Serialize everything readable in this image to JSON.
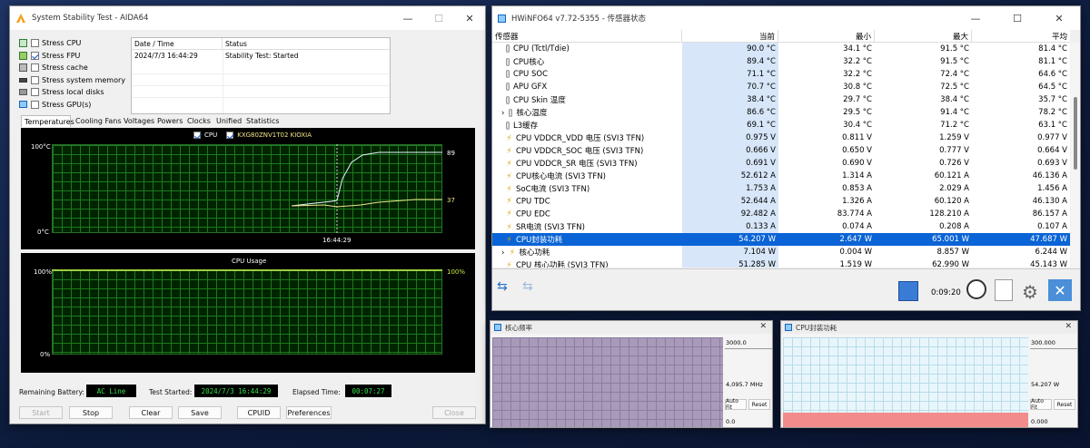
{
  "aida": {
    "title": "System Stability Test - AIDA64",
    "stress": [
      {
        "label": "Stress CPU",
        "checked": false
      },
      {
        "label": "Stress FPU",
        "checked": true
      },
      {
        "label": "Stress cache",
        "checked": false
      },
      {
        "label": "Stress system memory",
        "checked": false
      },
      {
        "label": "Stress local disks",
        "checked": false
      },
      {
        "label": "Stress GPU(s)",
        "checked": false
      }
    ],
    "log": {
      "col_date": "Date / Time",
      "col_status": "Status",
      "row_date": "2024/7/3 16:44:29",
      "row_status": "Stability Test: Started"
    },
    "tabs": [
      "Temperatures",
      "Cooling Fans",
      "Voltages",
      "Powers",
      "Clocks",
      "Unified",
      "Statistics"
    ],
    "temp_graph": {
      "legend_cpu": "CPU",
      "legend_disk": "KXG80ZNV1T02 KIOXIA",
      "y_top": "100°C",
      "y_bottom": "0°C",
      "x_time": "16:44:29",
      "val_cpu": "89",
      "val_disk": "37"
    },
    "usage_graph": {
      "title": "CPU Usage",
      "y_top": "100%",
      "y_bottom": "0%",
      "val": "100%"
    },
    "status": {
      "battery_label": "Remaining Battery:",
      "battery": "AC Line",
      "started_label": "Test Started:",
      "started": "2024/7/3 16:44:29",
      "elapsed_label": "Elapsed Time:",
      "elapsed": "00:07:27"
    },
    "buttons": {
      "start": "Start",
      "stop": "Stop",
      "clear": "Clear",
      "save": "Save",
      "cpuid": "CPUID",
      "prefs": "Preferences",
      "close": "Close"
    },
    "colors": {
      "cpu_line": "#e8f4ff",
      "disk_line": "#f0e68c",
      "usage_line": "#c6e84a"
    }
  },
  "hwinfo": {
    "title": "HWiNFO64 v7.72-5355 - 传感器状态",
    "headers": {
      "sensor": "传感器",
      "current": "当前",
      "min": "最小",
      "max": "最大",
      "avg": "平均"
    },
    "rows": [
      {
        "icon": "thermometer-icon",
        "name": "CPU (Tctl/Tdie)",
        "cur": "90.0 °C",
        "min": "34.1 °C",
        "max": "91.5 °C",
        "avg": "81.4 °C"
      },
      {
        "icon": "thermometer-icon",
        "name": "CPU核心",
        "cur": "89.4 °C",
        "min": "32.2 °C",
        "max": "91.5 °C",
        "avg": "81.1 °C"
      },
      {
        "icon": "thermometer-icon",
        "name": "CPU SOC",
        "cur": "71.1 °C",
        "min": "32.2 °C",
        "max": "72.4 °C",
        "avg": "64.6 °C"
      },
      {
        "icon": "thermometer-icon",
        "name": "APU GFX",
        "cur": "70.7 °C",
        "min": "30.8 °C",
        "max": "72.5 °C",
        "avg": "64.5 °C"
      },
      {
        "icon": "thermometer-icon",
        "name": "CPU Skin 温度",
        "cur": "38.4 °C",
        "min": "29.7 °C",
        "max": "38.4 °C",
        "avg": "35.7 °C"
      },
      {
        "icon": "thermometer-icon",
        "name": "核心温度",
        "expand": true,
        "cur": "86.6 °C",
        "min": "29.5 °C",
        "max": "91.4 °C",
        "avg": "78.2 °C"
      },
      {
        "icon": "thermometer-icon",
        "name": "L3缓存",
        "cur": "69.1 °C",
        "min": "30.4 °C",
        "max": "71.2 °C",
        "avg": "63.1 °C"
      },
      {
        "icon": "bolt-icon",
        "name": "CPU VDDCR_VDD 电压 (SVI3 TFN)",
        "cur": "0.975 V",
        "min": "0.811 V",
        "max": "1.259 V",
        "avg": "0.977 V"
      },
      {
        "icon": "bolt-icon",
        "name": "CPU VDDCR_SOC 电压 (SVI3 TFN)",
        "cur": "0.666 V",
        "min": "0.650 V",
        "max": "0.777 V",
        "avg": "0.664 V"
      },
      {
        "icon": "bolt-icon",
        "name": "CPU VDDCR_SR 电压 (SVI3 TFN)",
        "cur": "0.691 V",
        "min": "0.690 V",
        "max": "0.726 V",
        "avg": "0.693 V"
      },
      {
        "icon": "bolt-icon",
        "name": "CPU核心电流 (SVI3 TFN)",
        "cur": "52.612 A",
        "min": "1.314 A",
        "max": "60.121 A",
        "avg": "46.136 A"
      },
      {
        "icon": "bolt-icon",
        "name": "SoC电流 (SVI3 TFN)",
        "cur": "1.753 A",
        "min": "0.853 A",
        "max": "2.029 A",
        "avg": "1.456 A"
      },
      {
        "icon": "bolt-icon",
        "name": "CPU TDC",
        "cur": "52.644 A",
        "min": "1.326 A",
        "max": "60.120 A",
        "avg": "46.130 A"
      },
      {
        "icon": "bolt-icon",
        "name": "CPU EDC",
        "cur": "92.482 A",
        "min": "83.774 A",
        "max": "128.210 A",
        "avg": "86.157 A"
      },
      {
        "icon": "bolt-icon",
        "name": "SR电流 (SVI3 TFN)",
        "cur": "0.133 A",
        "min": "0.074 A",
        "max": "0.208 A",
        "avg": "0.107 A"
      },
      {
        "icon": "bolt-icon",
        "name": "CPU封装功耗",
        "selected": true,
        "cur": "54.207 W",
        "min": "2.647 W",
        "max": "65.001 W",
        "avg": "47.687 W"
      },
      {
        "icon": "bolt-icon",
        "name": "核心功耗",
        "expand": true,
        "cur": "7.104 W",
        "min": "0.004 W",
        "max": "8.857 W",
        "avg": "6.244 W"
      },
      {
        "icon": "bolt-icon",
        "name": "CPU 核心功耗 (SVI3 TFN)",
        "cur": "51.285 W",
        "min": "1.519 W",
        "max": "62.990 W",
        "avg": "45.143 W"
      }
    ],
    "timer": "0:09:20"
  },
  "graph1": {
    "title": "核心频率",
    "max": "3000.0",
    "cur": "4,095.7 MHz",
    "min": "0.0",
    "auto": "Auto Fit",
    "reset": "Reset",
    "color": "#a89ab8"
  },
  "graph2": {
    "title": "CPU封装功耗",
    "max": "300.000",
    "cur": "54.207 W",
    "min": "0.000",
    "auto": "Auto Fit",
    "reset": "Reset",
    "color": "#f28c8c"
  }
}
